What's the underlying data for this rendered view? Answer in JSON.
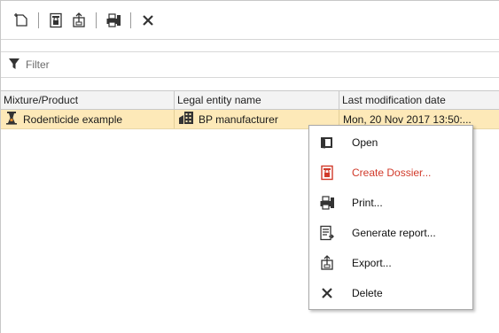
{
  "toolbar": {
    "buttons": [
      {
        "icon": "new-item-icon"
      },
      {
        "icon": "create-dossier-icon"
      },
      {
        "icon": "export-icon"
      },
      {
        "icon": "print-icon"
      },
      {
        "icon": "delete-icon"
      }
    ]
  },
  "filter": {
    "placeholder": "Filter",
    "icon": "funnel-icon"
  },
  "table": {
    "columns": [
      "Mixture/Product",
      "Legal entity name",
      "Last modification date"
    ],
    "rows": [
      {
        "product": "Rodenticide example",
        "product_icon": "mixture-product-icon",
        "legal_entity": "BP manufacturer",
        "legal_entity_icon": "building-icon",
        "last_modified": "Mon, 20 Nov 2017 13:50:..."
      }
    ],
    "selected_row_color": "#fde9b8"
  },
  "context_menu": {
    "items": [
      {
        "label": "Open",
        "icon": "open-icon"
      },
      {
        "label": "Create Dossier...",
        "icon": "create-dossier-icon",
        "accent": "#d13a2a"
      },
      {
        "label": "Print...",
        "icon": "print-icon"
      },
      {
        "label": "Generate report...",
        "icon": "generate-report-icon"
      },
      {
        "label": "Export...",
        "icon": "export-icon"
      },
      {
        "label": "Delete",
        "icon": "delete-icon"
      }
    ]
  }
}
